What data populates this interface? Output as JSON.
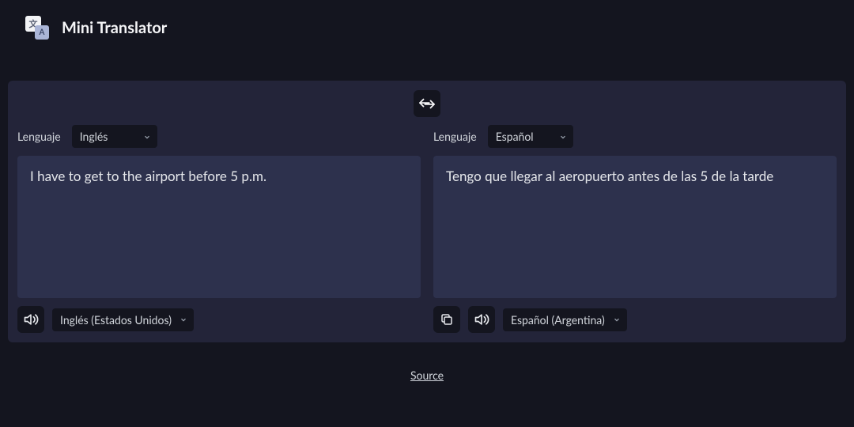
{
  "header": {
    "title": "Mini Translator",
    "logo_char1": "文",
    "logo_char2": "A"
  },
  "panel": {
    "source": {
      "lang_label": "Lenguaje",
      "lang_selected": "Inglés",
      "text": "I have to get to the airport before 5 p.m.",
      "voice_selected": "Inglés (Estados Unidos)"
    },
    "target": {
      "lang_label": "Lenguaje",
      "lang_selected": "Español",
      "text": "Tengo que llegar al aeropuerto antes de las 5 de la tarde",
      "voice_selected": "Español (Argentina)"
    }
  },
  "footer": {
    "source_link": "Source"
  }
}
